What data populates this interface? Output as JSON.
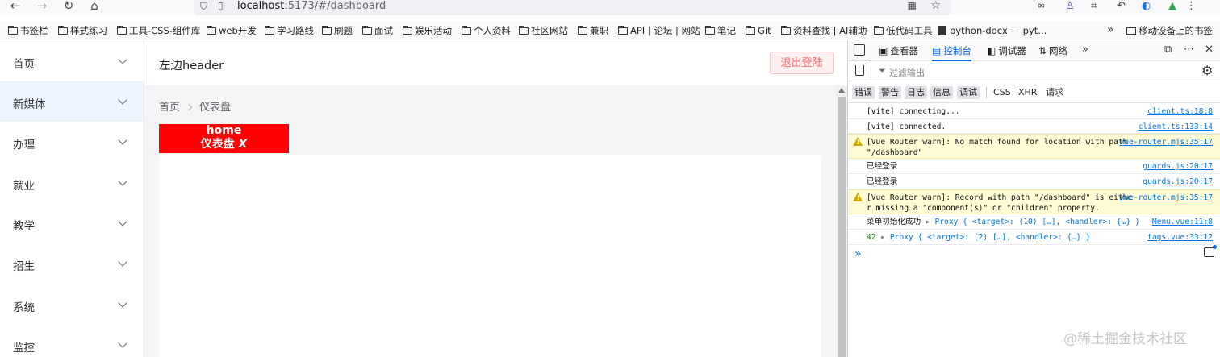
{
  "browser": {
    "url_host": "localhost",
    "url_rest": ":5173/#/dashboard",
    "bookmarks": [
      "书签栏",
      "样式练习",
      "工具-CSS-组件库",
      "web开发",
      "学习路线",
      "刷题",
      "面试",
      "娱乐活动",
      "个人资料",
      "社区网站",
      "兼职",
      "API | 论坛 | 网站",
      "笔记",
      "Git",
      "资料查找 | AI辅助",
      "低代码工具",
      "python-docx — pyt..."
    ],
    "mobile_bookmarks": "移动设备上的书签"
  },
  "sidebar": {
    "items": [
      {
        "label": "首页"
      },
      {
        "label": "新媒体"
      },
      {
        "label": "办理"
      },
      {
        "label": "就业"
      },
      {
        "label": "教学"
      },
      {
        "label": "招生"
      },
      {
        "label": "系统"
      },
      {
        "label": "监控"
      }
    ],
    "active_index": 1
  },
  "header": {
    "title": "左边header",
    "logout_label": "退出登陆"
  },
  "breadcrumb": {
    "home": "首页",
    "current": "仪表盘"
  },
  "tag": {
    "line1": "home",
    "line2": "仪表盘",
    "close": "X",
    "color": "#ff0000"
  },
  "devtools": {
    "tabs": [
      "查看器",
      "控制台",
      "调试器",
      "网络"
    ],
    "active_tab": "控制台",
    "filter_placeholder": "过滤输出",
    "levels": [
      "错误",
      "警告",
      "日志",
      "信息",
      "调试"
    ],
    "types": [
      "CSS",
      "XHR",
      "请求"
    ],
    "logs": [
      {
        "type": "log",
        "msg": "[vite] connecting...",
        "src": "client.ts:18:8"
      },
      {
        "type": "log",
        "msg": "[vite] connected.",
        "src": "client.ts:133:14"
      },
      {
        "type": "warn",
        "msg": "[Vue Router warn]: No match found for location with path \"/dashboard\"",
        "src": "vue-router.mjs:35:17"
      },
      {
        "type": "log",
        "msg": "已经登录",
        "src": "guards.js:20:17"
      },
      {
        "type": "log",
        "msg": "已经登录",
        "src": "guards.js:20:17"
      },
      {
        "type": "warn",
        "msg": "[Vue Router warn]: Record with path \"/dashboard\" is either missing a \"component(s)\" or \"children\" property.",
        "src": "vue-router.mjs:35:17"
      },
      {
        "type": "log",
        "msg": "菜单初始化成功",
        "obj": "Proxy { <target>: (10) […], <handler>: {…} }",
        "src": "Menu.vue:11:8"
      },
      {
        "type": "log",
        "num": "42",
        "obj": "Proxy { <target>: (2) […], <handler>: {…} }",
        "src": "tags.vue:33:12"
      }
    ]
  },
  "watermark": "@稀土掘金技术社区"
}
